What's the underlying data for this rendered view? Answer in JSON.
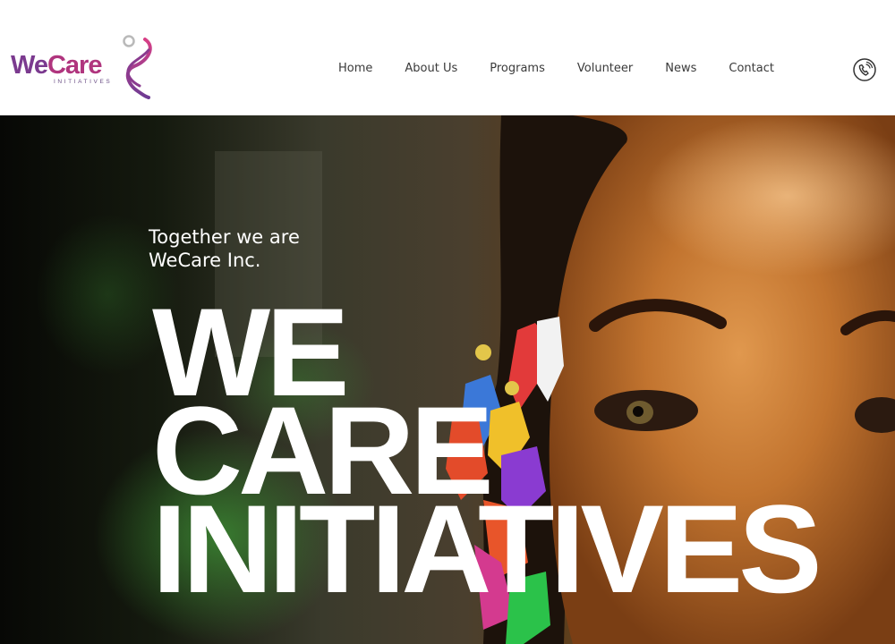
{
  "brand": {
    "name_part1": "We",
    "name_part2": "Care",
    "subtitle": "INITIATIVES",
    "colors": {
      "purple": "#7b3a8f",
      "magenta": "#b0357e",
      "teal": "#2bb5b0"
    }
  },
  "nav": {
    "items": [
      "Home",
      "About Us",
      "Programs",
      "Volunteer",
      "News",
      "Contact"
    ]
  },
  "contact": {
    "icon": "phone-icon"
  },
  "hero": {
    "tagline_line1": "Together we are",
    "tagline_line2": "WeCare Inc.",
    "headline": [
      "WE",
      "CARE",
      "INITIATIVES"
    ]
  }
}
